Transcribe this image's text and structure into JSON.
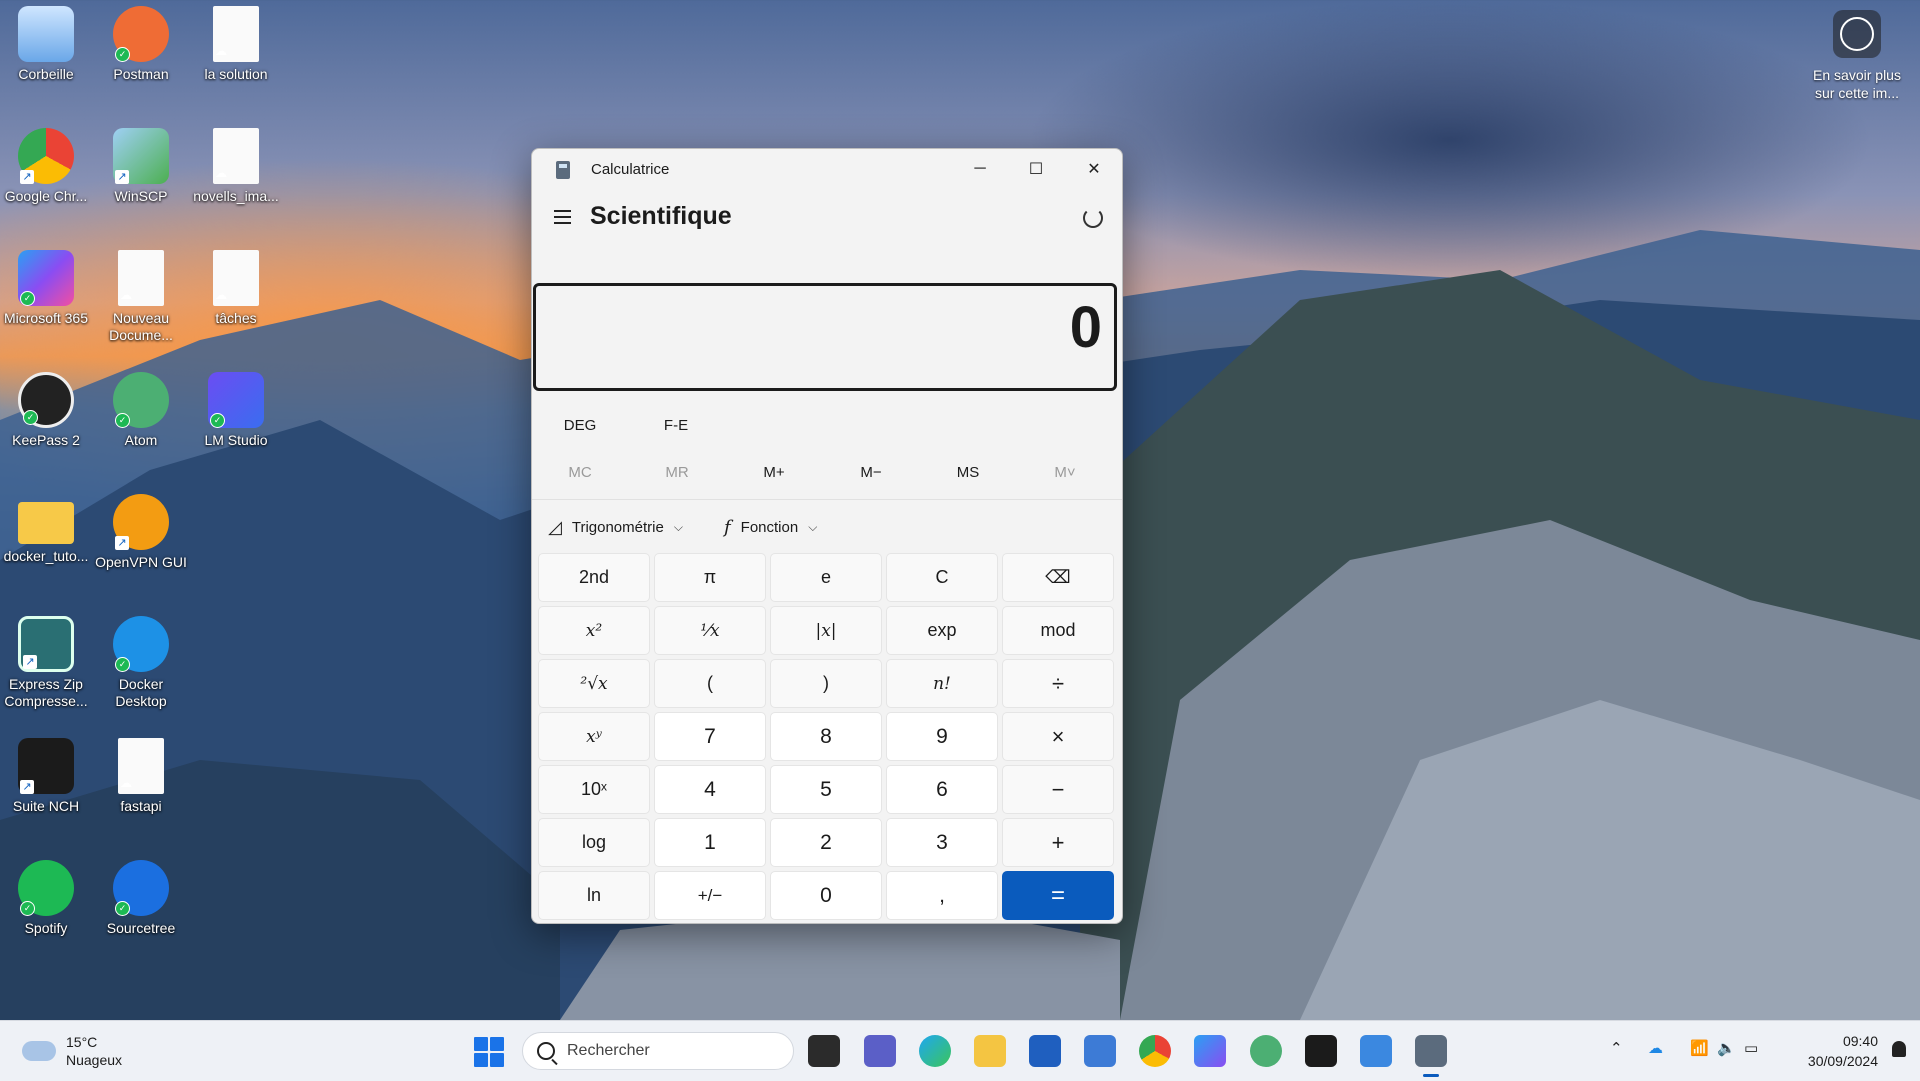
{
  "desktop": {
    "icons": [
      {
        "label": "Corbeille",
        "icon": "recycle-bin-icon"
      },
      {
        "label": "Postman",
        "icon": "postman-icon"
      },
      {
        "label": "la solution",
        "icon": "document-icon"
      },
      {
        "label": "Google Chr...",
        "icon": "chrome-icon"
      },
      {
        "label": "WinSCP",
        "icon": "winscp-icon"
      },
      {
        "label": "novells_ima...",
        "icon": "document-icon"
      },
      {
        "label": "Microsoft 365",
        "icon": "microsoft365-icon"
      },
      {
        "label": "Nouveau Docume...",
        "icon": "document-icon"
      },
      {
        "label": "tâches",
        "icon": "document-icon"
      },
      {
        "label": "KeePass 2",
        "icon": "keepass-icon"
      },
      {
        "label": "Atom",
        "icon": "atom-icon"
      },
      {
        "label": "LM Studio",
        "icon": "lm-studio-icon"
      },
      {
        "label": "docker_tuto...",
        "icon": "folder-icon"
      },
      {
        "label": "OpenVPN GUI",
        "icon": "openvpn-icon"
      },
      {
        "label": "Express Zip Compresse...",
        "icon": "express-zip-icon"
      },
      {
        "label": "Docker Desktop",
        "icon": "docker-icon"
      },
      {
        "label": "Suite NCH",
        "icon": "nch-suite-icon"
      },
      {
        "label": "fastapi",
        "icon": "document-icon"
      },
      {
        "label": "Spotify",
        "icon": "spotify-icon"
      },
      {
        "label": "Sourcetree",
        "icon": "sourcetree-icon"
      }
    ],
    "spotlight": "En savoir plus sur cette im..."
  },
  "calculator": {
    "window_title": "Calculatrice",
    "mode": "Scientifique",
    "display_value": "0",
    "angle_unit": "DEG",
    "fe_label": "F-E",
    "memory": [
      "MC",
      "MR",
      "M+",
      "M−",
      "MS",
      "M˅"
    ],
    "trig_label": "Trigonométrie",
    "func_label": "Fonction",
    "keys": [
      [
        "2nd",
        "π",
        "e",
        "C",
        "⌫"
      ],
      [
        "x²",
        "¹⁄x",
        "|x|",
        "exp",
        "mod"
      ],
      [
        "²√x",
        "(",
        ")",
        "n!",
        "÷"
      ],
      [
        "xʸ",
        "7",
        "8",
        "9",
        "×"
      ],
      [
        "10ˣ",
        "4",
        "5",
        "6",
        "−"
      ],
      [
        "log",
        "1",
        "2",
        "3",
        "+"
      ],
      [
        "ln",
        "+/−",
        "0",
        ",",
        "="
      ]
    ]
  },
  "taskbar": {
    "weather_temp": "15°C",
    "weather_desc": "Nuageux",
    "search_placeholder": "Rechercher",
    "time": "09:40",
    "date": "30/09/2024"
  },
  "colors": {
    "accent": "#0a5bbd",
    "calc_bg": "#f3f3f3"
  }
}
